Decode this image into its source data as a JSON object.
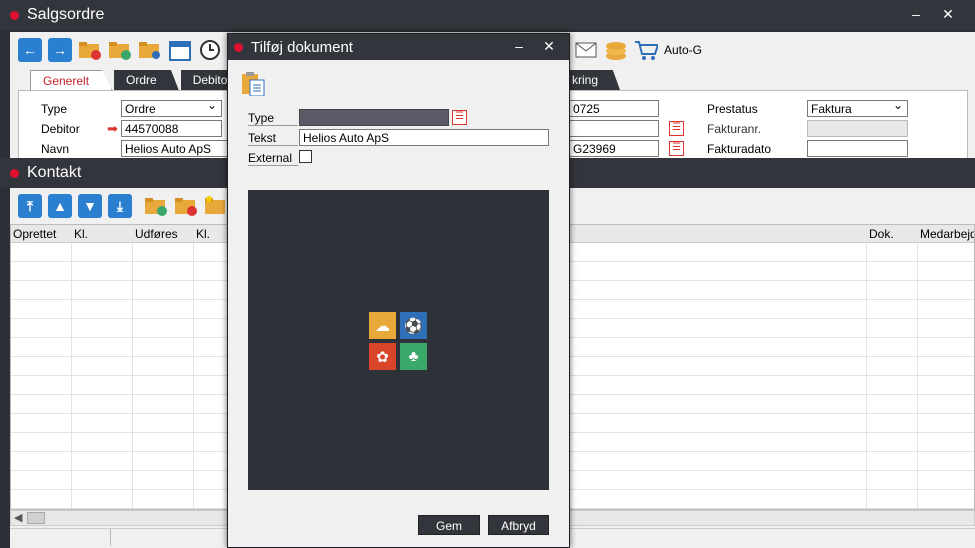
{
  "salgsordre": {
    "title": "Salgsordre",
    "minimize": "–",
    "close": "✕",
    "toolbar": {
      "auto_label": "Auto-G"
    },
    "tabs": [
      "Generelt",
      "Ordre",
      "Debitor",
      "kring"
    ],
    "form": {
      "type_label": "Type",
      "type_value": "Ordre",
      "debitor_label": "Debitor",
      "debitor_value": "44570088",
      "navn_label": "Navn",
      "navn_value": "Helios Auto ApS",
      "right_val1": "0725",
      "right_val3": "G23969",
      "prestatus_label": "Prestatus",
      "prestatus_value": "Faktura",
      "fakturanr_label": "Fakturanr.",
      "fakturanr_value": "",
      "fakturadato_label": "Fakturadato",
      "fakturadato_value": ""
    }
  },
  "kontakt": {
    "title": "Kontakt",
    "columns": [
      "Oprettet",
      "Kl.",
      "Udføres",
      "Kl.",
      "Dok.",
      "Medarbejd"
    ]
  },
  "dialog": {
    "title": "Tilføj dokument",
    "minimize": "–",
    "close": "✕",
    "type_label": "Type",
    "type_value": "",
    "tekst_label": "Tekst",
    "tekst_value": "Helios Auto ApS",
    "external_label": "External",
    "save_label": "Gem",
    "cancel_label": "Afbryd",
    "tile_colors": [
      "#e9a83a",
      "#2f6fb8",
      "#d9452a",
      "#3aa86b"
    ]
  }
}
